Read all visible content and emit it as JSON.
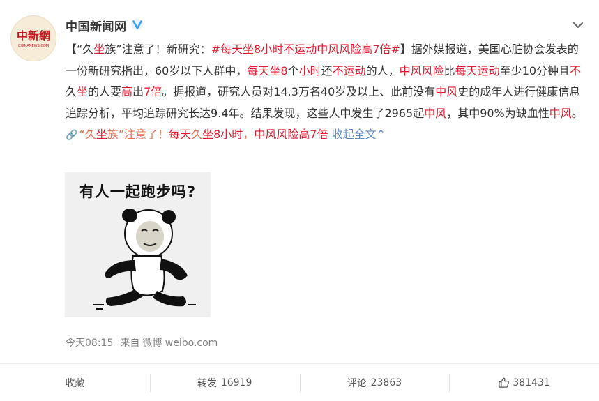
{
  "author": {
    "name": "中国新闻网",
    "verified": true,
    "avatar_text": "中新網",
    "avatar_subtext": "CHINANEWS.COM"
  },
  "post": {
    "segments": [
      {
        "text": "【“久",
        "style": "plain"
      },
      {
        "text": "坐",
        "style": "hl"
      },
      {
        "text": "族”注意了！新研究：",
        "style": "plain"
      },
      {
        "text": "#每天坐8小时不运动中风风险高7倍#",
        "style": "tag"
      },
      {
        "text": "】据外媒报道，美国心脏协会发表的一份新研究指出，60岁以下人群中，",
        "style": "plain"
      },
      {
        "text": "每天坐8",
        "style": "hl"
      },
      {
        "text": "个",
        "style": "plain"
      },
      {
        "text": "小时",
        "style": "hl"
      },
      {
        "text": "还",
        "style": "plain"
      },
      {
        "text": "不运动",
        "style": "hl"
      },
      {
        "text": "的人，",
        "style": "plain"
      },
      {
        "text": "中风风险",
        "style": "hl"
      },
      {
        "text": "比",
        "style": "plain"
      },
      {
        "text": "每天运动",
        "style": "hl"
      },
      {
        "text": "至少10分钟且",
        "style": "plain"
      },
      {
        "text": "不",
        "style": "hl"
      },
      {
        "text": "久",
        "style": "plain"
      },
      {
        "text": "坐",
        "style": "hl"
      },
      {
        "text": "的人要",
        "style": "plain"
      },
      {
        "text": "高",
        "style": "hl"
      },
      {
        "text": "出",
        "style": "plain"
      },
      {
        "text": "7倍",
        "style": "hl"
      },
      {
        "text": "。据报道，研究人员对14.3万名40岁及以上、此前没有",
        "style": "plain"
      },
      {
        "text": "中风",
        "style": "hl"
      },
      {
        "text": "史的成年人进行健康信息追踪分析，平均追踪研究长达9.4年。结果发现，这些人中发生了2965起",
        "style": "plain"
      },
      {
        "text": "中风",
        "style": "hl"
      },
      {
        "text": "，其中90%为缺血性",
        "style": "plain"
      },
      {
        "text": "中风",
        "style": "hl"
      },
      {
        "text": "。",
        "style": "plain"
      }
    ],
    "link_segments": [
      {
        "text": "“久",
        "style": "link"
      },
      {
        "text": "坐",
        "style": "linkhl"
      },
      {
        "text": "族”注意了！",
        "style": "link"
      },
      {
        "text": "每天",
        "style": "linkhl"
      },
      {
        "text": "久",
        "style": "link"
      },
      {
        "text": "坐8小时",
        "style": "linkhl"
      },
      {
        "text": "，",
        "style": "link"
      },
      {
        "text": "中风风险高7倍",
        "style": "linkhl"
      }
    ],
    "collapse_label": "收起全文",
    "collapse_arrow": "⌃"
  },
  "image": {
    "caption": "有人一起跑步吗?"
  },
  "meta": {
    "time": "今天08:15",
    "source_prefix": "来自",
    "source": "微博 weibo.com"
  },
  "actions": {
    "favorite": "收藏",
    "repost_label": "转发",
    "repost_count": "16919",
    "comment_label": "评论",
    "comment_count": "23863",
    "like_count": "381431"
  },
  "colors": {
    "highlight": "#e6162d",
    "link": "#eb7350",
    "blue": "#5f8ac6",
    "meta": "#808080"
  },
  "icons": {
    "verified": "verified-badge-icon",
    "menu": "chevron-down-icon",
    "link": "link-icon",
    "like": "thumbs-up-icon"
  }
}
